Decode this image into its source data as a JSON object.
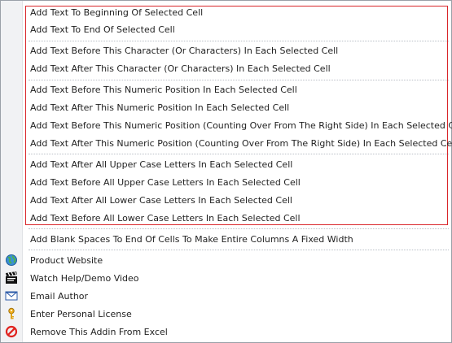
{
  "menu": {
    "items": [
      {
        "label": "Add Text To Beginning Of Selected Cell"
      },
      {
        "label": "Add Text To End Of Selected Cell"
      },
      {
        "label": "Add Text Before This Character (Or Characters) In Each Selected Cell"
      },
      {
        "label": "Add Text After This Character (Or Characters) In Each Selected Cell"
      },
      {
        "label": "Add Text Before This Numeric Position In Each Selected Cell"
      },
      {
        "label": "Add Text After This Numeric Position In Each Selected Cell"
      },
      {
        "label": "Add Text Before This Numeric Position (Counting Over From The Right Side) In Each Selected Cell"
      },
      {
        "label": "Add Text After This Numeric Position (Counting Over From The Right Side) In Each Selected Cell"
      },
      {
        "label": "Add Text After All Upper Case Letters In Each Selected Cell"
      },
      {
        "label": "Add Text Before All Upper Case Letters In Each Selected Cell"
      },
      {
        "label": "Add Text After All Lower Case Letters In Each Selected Cell"
      },
      {
        "label": "Add Text Before All Lower Case Letters In Each Selected Cell"
      },
      {
        "label": "Add Blank Spaces To End Of Cells To Make Entire Columns A Fixed Width"
      },
      {
        "label": "Product Website",
        "icon": "globe-icon"
      },
      {
        "label": "Watch Help/Demo Video",
        "icon": "clapperboard-icon"
      },
      {
        "label": "Email Author",
        "icon": "envelope-icon"
      },
      {
        "label": "Enter Personal License",
        "icon": "key-icon"
      },
      {
        "label": "Remove This Addin From Excel",
        "icon": "prohibited-icon"
      }
    ]
  },
  "colors": {
    "highlight_border": "#d9262a",
    "text": "#1f1f1f",
    "gutter": "#f1f2f4",
    "separator": "#b9bec6"
  }
}
